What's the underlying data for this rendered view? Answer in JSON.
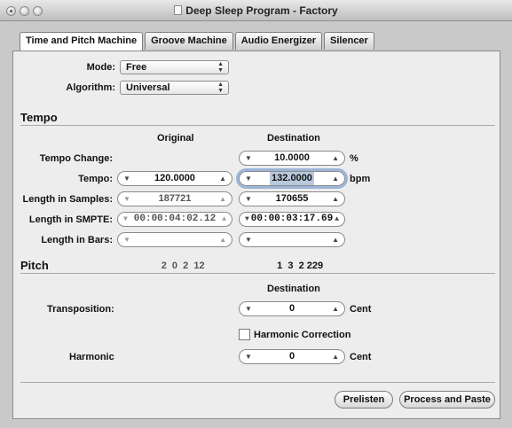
{
  "window": {
    "title": "Deep Sleep Program - Factory"
  },
  "tabs": [
    {
      "label": "Time and Pitch Machine",
      "active": true
    },
    {
      "label": "Groove Machine",
      "active": false
    },
    {
      "label": "Audio Energizer",
      "active": false
    },
    {
      "label": "Silencer",
      "active": false
    }
  ],
  "mode": {
    "label": "Mode:",
    "value": "Free"
  },
  "algorithm": {
    "label": "Algorithm:",
    "value": "Universal"
  },
  "tempo": {
    "section_title": "Tempo",
    "col_original": "Original",
    "col_destination": "Destination",
    "rows": {
      "tempo_change": {
        "label": "Tempo Change:",
        "destination": "10.0000",
        "unit": "%"
      },
      "tempo": {
        "label": "Tempo:",
        "original": "120.0000",
        "destination": "132.0000",
        "unit": "bpm"
      },
      "length_samples": {
        "label": "Length in Samples:",
        "original": "187721",
        "destination": "170655"
      },
      "length_smpte": {
        "label": "Length in SMPTE:",
        "original": "00:00:04:02.12",
        "destination": "00:00:03:17.69"
      },
      "length_bars": {
        "label": "Length in Bars:",
        "original": "2  0  2  12",
        "destination": "1  3  2 229"
      }
    }
  },
  "pitch": {
    "section_title": "Pitch",
    "col_destination": "Destination",
    "transposition": {
      "label": "Transposition:",
      "value": "0",
      "unit": "Cent"
    },
    "harmonic_correction": {
      "label": "Harmonic Correction",
      "checked": false
    },
    "harmonic": {
      "label": "Harmonic",
      "value": "0",
      "unit": "Cent"
    }
  },
  "buttons": {
    "prelisten": "Prelisten",
    "process_and_paste": "Process and Paste"
  },
  "icons": {
    "stepper_down": "▼",
    "stepper_up": "▲",
    "popup_arrows": "▲\n▼"
  }
}
